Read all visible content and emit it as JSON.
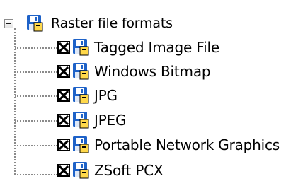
{
  "tree": {
    "root": {
      "label": "Raster file formats",
      "expanded": true,
      "icon": "save-disk-icon"
    },
    "items": [
      {
        "label": "Tagged Image File",
        "checked": true,
        "icon": "save-disk-icon"
      },
      {
        "label": "Windows Bitmap",
        "checked": true,
        "icon": "save-disk-icon"
      },
      {
        "label": "JPG",
        "checked": true,
        "icon": "save-disk-icon"
      },
      {
        "label": "JPEG",
        "checked": true,
        "icon": "save-disk-icon"
      },
      {
        "label": "Portable Network Graphics",
        "checked": true,
        "icon": "save-disk-icon"
      },
      {
        "label": "ZSoft PCX",
        "checked": true,
        "icon": "save-disk-icon"
      }
    ]
  },
  "colors": {
    "disk_blue": "#1e62c8",
    "disk_shutter": "#ffd84a",
    "connector": "#8a8a8a"
  }
}
